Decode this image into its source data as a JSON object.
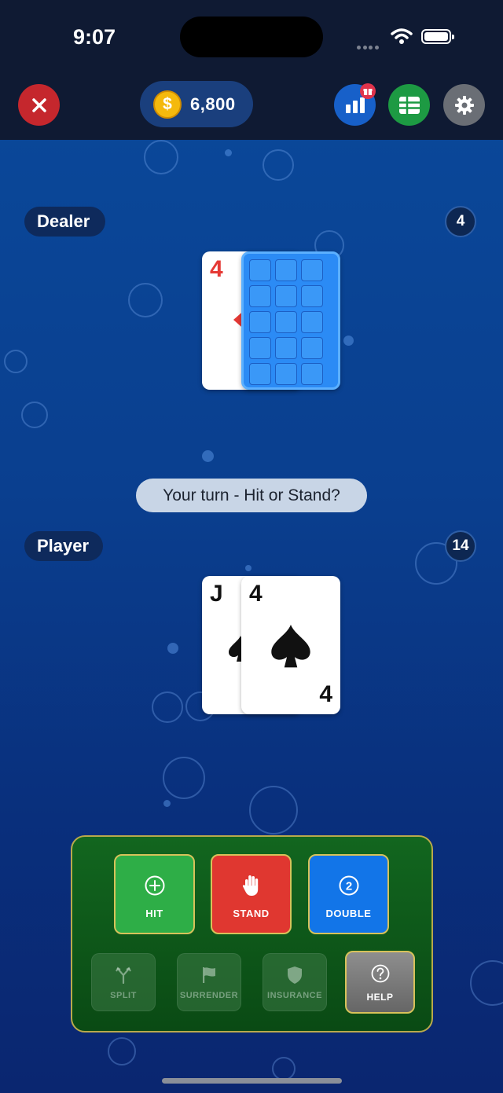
{
  "status_bar": {
    "time": "9:07"
  },
  "header": {
    "coins": "6,800",
    "coin_symbol": "$"
  },
  "dealer": {
    "label": "Dealer",
    "score": "4",
    "cards": [
      {
        "rank": "4",
        "suit": "diamonds",
        "color": "#e53935",
        "face_up": true
      },
      {
        "face_up": false
      }
    ]
  },
  "message": "Your turn - Hit or Stand?",
  "player": {
    "label": "Player",
    "score": "14",
    "cards": [
      {
        "rank": "J",
        "suit": "spades",
        "color": "#111111"
      },
      {
        "rank": "4",
        "suit": "spades",
        "color": "#111111"
      }
    ]
  },
  "actions": {
    "hit": "HIT",
    "stand": "STAND",
    "double": "DOUBLE",
    "double_icon_number": "2",
    "split": "SPLIT",
    "surrender": "SURRENDER",
    "insurance": "INSURANCE",
    "help": "HELP"
  },
  "colors": {
    "hit": "#2eae47",
    "stand": "#e03730",
    "double": "#1275e8",
    "close": "#c5272d"
  }
}
